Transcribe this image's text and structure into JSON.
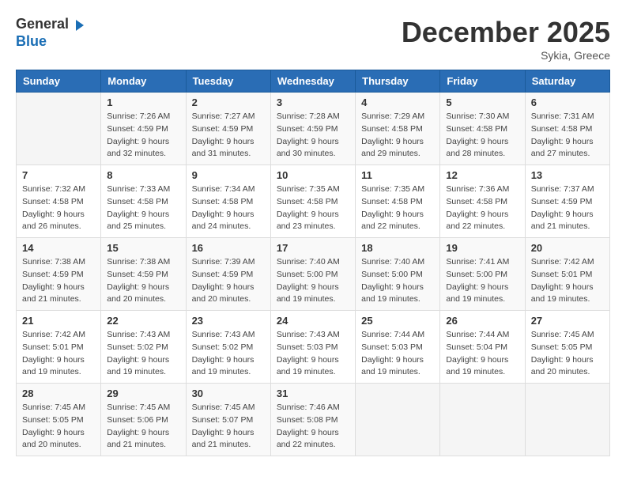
{
  "header": {
    "logo_general": "General",
    "logo_blue": "Blue",
    "month_year": "December 2025",
    "location": "Sykia, Greece"
  },
  "weekdays": [
    "Sunday",
    "Monday",
    "Tuesday",
    "Wednesday",
    "Thursday",
    "Friday",
    "Saturday"
  ],
  "weeks": [
    [
      {
        "day": "",
        "sunrise": "",
        "sunset": "",
        "daylight": ""
      },
      {
        "day": "1",
        "sunrise": "Sunrise: 7:26 AM",
        "sunset": "Sunset: 4:59 PM",
        "daylight": "Daylight: 9 hours and 32 minutes."
      },
      {
        "day": "2",
        "sunrise": "Sunrise: 7:27 AM",
        "sunset": "Sunset: 4:59 PM",
        "daylight": "Daylight: 9 hours and 31 minutes."
      },
      {
        "day": "3",
        "sunrise": "Sunrise: 7:28 AM",
        "sunset": "Sunset: 4:59 PM",
        "daylight": "Daylight: 9 hours and 30 minutes."
      },
      {
        "day": "4",
        "sunrise": "Sunrise: 7:29 AM",
        "sunset": "Sunset: 4:58 PM",
        "daylight": "Daylight: 9 hours and 29 minutes."
      },
      {
        "day": "5",
        "sunrise": "Sunrise: 7:30 AM",
        "sunset": "Sunset: 4:58 PM",
        "daylight": "Daylight: 9 hours and 28 minutes."
      },
      {
        "day": "6",
        "sunrise": "Sunrise: 7:31 AM",
        "sunset": "Sunset: 4:58 PM",
        "daylight": "Daylight: 9 hours and 27 minutes."
      }
    ],
    [
      {
        "day": "7",
        "sunrise": "Sunrise: 7:32 AM",
        "sunset": "Sunset: 4:58 PM",
        "daylight": "Daylight: 9 hours and 26 minutes."
      },
      {
        "day": "8",
        "sunrise": "Sunrise: 7:33 AM",
        "sunset": "Sunset: 4:58 PM",
        "daylight": "Daylight: 9 hours and 25 minutes."
      },
      {
        "day": "9",
        "sunrise": "Sunrise: 7:34 AM",
        "sunset": "Sunset: 4:58 PM",
        "daylight": "Daylight: 9 hours and 24 minutes."
      },
      {
        "day": "10",
        "sunrise": "Sunrise: 7:35 AM",
        "sunset": "Sunset: 4:58 PM",
        "daylight": "Daylight: 9 hours and 23 minutes."
      },
      {
        "day": "11",
        "sunrise": "Sunrise: 7:35 AM",
        "sunset": "Sunset: 4:58 PM",
        "daylight": "Daylight: 9 hours and 22 minutes."
      },
      {
        "day": "12",
        "sunrise": "Sunrise: 7:36 AM",
        "sunset": "Sunset: 4:58 PM",
        "daylight": "Daylight: 9 hours and 22 minutes."
      },
      {
        "day": "13",
        "sunrise": "Sunrise: 7:37 AM",
        "sunset": "Sunset: 4:59 PM",
        "daylight": "Daylight: 9 hours and 21 minutes."
      }
    ],
    [
      {
        "day": "14",
        "sunrise": "Sunrise: 7:38 AM",
        "sunset": "Sunset: 4:59 PM",
        "daylight": "Daylight: 9 hours and 21 minutes."
      },
      {
        "day": "15",
        "sunrise": "Sunrise: 7:38 AM",
        "sunset": "Sunset: 4:59 PM",
        "daylight": "Daylight: 9 hours and 20 minutes."
      },
      {
        "day": "16",
        "sunrise": "Sunrise: 7:39 AM",
        "sunset": "Sunset: 4:59 PM",
        "daylight": "Daylight: 9 hours and 20 minutes."
      },
      {
        "day": "17",
        "sunrise": "Sunrise: 7:40 AM",
        "sunset": "Sunset: 5:00 PM",
        "daylight": "Daylight: 9 hours and 19 minutes."
      },
      {
        "day": "18",
        "sunrise": "Sunrise: 7:40 AM",
        "sunset": "Sunset: 5:00 PM",
        "daylight": "Daylight: 9 hours and 19 minutes."
      },
      {
        "day": "19",
        "sunrise": "Sunrise: 7:41 AM",
        "sunset": "Sunset: 5:00 PM",
        "daylight": "Daylight: 9 hours and 19 minutes."
      },
      {
        "day": "20",
        "sunrise": "Sunrise: 7:42 AM",
        "sunset": "Sunset: 5:01 PM",
        "daylight": "Daylight: 9 hours and 19 minutes."
      }
    ],
    [
      {
        "day": "21",
        "sunrise": "Sunrise: 7:42 AM",
        "sunset": "Sunset: 5:01 PM",
        "daylight": "Daylight: 9 hours and 19 minutes."
      },
      {
        "day": "22",
        "sunrise": "Sunrise: 7:43 AM",
        "sunset": "Sunset: 5:02 PM",
        "daylight": "Daylight: 9 hours and 19 minutes."
      },
      {
        "day": "23",
        "sunrise": "Sunrise: 7:43 AM",
        "sunset": "Sunset: 5:02 PM",
        "daylight": "Daylight: 9 hours and 19 minutes."
      },
      {
        "day": "24",
        "sunrise": "Sunrise: 7:43 AM",
        "sunset": "Sunset: 5:03 PM",
        "daylight": "Daylight: 9 hours and 19 minutes."
      },
      {
        "day": "25",
        "sunrise": "Sunrise: 7:44 AM",
        "sunset": "Sunset: 5:03 PM",
        "daylight": "Daylight: 9 hours and 19 minutes."
      },
      {
        "day": "26",
        "sunrise": "Sunrise: 7:44 AM",
        "sunset": "Sunset: 5:04 PM",
        "daylight": "Daylight: 9 hours and 19 minutes."
      },
      {
        "day": "27",
        "sunrise": "Sunrise: 7:45 AM",
        "sunset": "Sunset: 5:05 PM",
        "daylight": "Daylight: 9 hours and 20 minutes."
      }
    ],
    [
      {
        "day": "28",
        "sunrise": "Sunrise: 7:45 AM",
        "sunset": "Sunset: 5:05 PM",
        "daylight": "Daylight: 9 hours and 20 minutes."
      },
      {
        "day": "29",
        "sunrise": "Sunrise: 7:45 AM",
        "sunset": "Sunset: 5:06 PM",
        "daylight": "Daylight: 9 hours and 21 minutes."
      },
      {
        "day": "30",
        "sunrise": "Sunrise: 7:45 AM",
        "sunset": "Sunset: 5:07 PM",
        "daylight": "Daylight: 9 hours and 21 minutes."
      },
      {
        "day": "31",
        "sunrise": "Sunrise: 7:46 AM",
        "sunset": "Sunset: 5:08 PM",
        "daylight": "Daylight: 9 hours and 22 minutes."
      },
      {
        "day": "",
        "sunrise": "",
        "sunset": "",
        "daylight": ""
      },
      {
        "day": "",
        "sunrise": "",
        "sunset": "",
        "daylight": ""
      },
      {
        "day": "",
        "sunrise": "",
        "sunset": "",
        "daylight": ""
      }
    ]
  ]
}
